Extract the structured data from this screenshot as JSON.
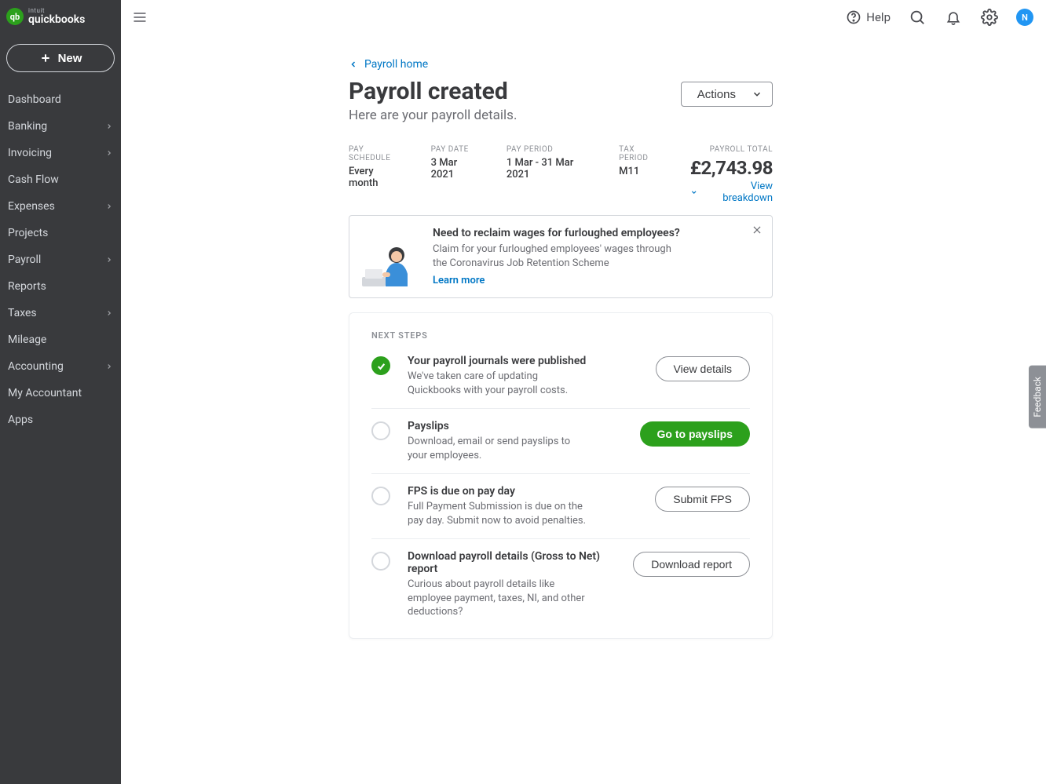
{
  "brand": {
    "intuit": "intuit",
    "name": "quickbooks",
    "mark": "qb"
  },
  "new_button": "New",
  "sidebar_items": [
    {
      "label": "Dashboard",
      "hasSub": false
    },
    {
      "label": "Banking",
      "hasSub": true
    },
    {
      "label": "Invoicing",
      "hasSub": true
    },
    {
      "label": "Cash Flow",
      "hasSub": false
    },
    {
      "label": "Expenses",
      "hasSub": true
    },
    {
      "label": "Projects",
      "hasSub": false
    },
    {
      "label": "Payroll",
      "hasSub": true
    },
    {
      "label": "Reports",
      "hasSub": false
    },
    {
      "label": "Taxes",
      "hasSub": true
    },
    {
      "label": "Mileage",
      "hasSub": false
    },
    {
      "label": "Accounting",
      "hasSub": true
    },
    {
      "label": "My Accountant",
      "hasSub": false
    },
    {
      "label": "Apps",
      "hasSub": false
    }
  ],
  "topbar": {
    "help_label": "Help",
    "avatar_initial": "N"
  },
  "breadcrumb": {
    "back_label": "Payroll home"
  },
  "page": {
    "title": "Payroll created",
    "subtitle": "Here are your payroll details.",
    "actions_label": "Actions"
  },
  "meta": {
    "pay_schedule_label": "PAY SCHEDULE",
    "pay_schedule_value": "Every month",
    "pay_date_label": "PAY DATE",
    "pay_date_value": "3 Mar 2021",
    "pay_period_label": "PAY PERIOD",
    "pay_period_value": "1 Mar - 31 Mar 2021",
    "tax_period_label": "TAX PERIOD",
    "tax_period_value": "M11",
    "payroll_total_label": "PAYROLL TOTAL",
    "payroll_total_value": "£2,743.98",
    "view_breakdown_label": "View breakdown"
  },
  "alert": {
    "title": "Need to reclaim wages for furloughed employees?",
    "desc": "Claim for your furloughed employees' wages through the Coronavirus Job Retention Scheme",
    "link": "Learn more"
  },
  "next_steps_heading": "NEXT STEPS",
  "steps": [
    {
      "done": true,
      "title": "Your payroll journals were published",
      "desc": "We've taken care of updating Quickbooks with your payroll costs.",
      "action": "View details",
      "primary": false
    },
    {
      "done": false,
      "title": "Payslips",
      "desc": "Download, email or send payslips to your employees.",
      "action": "Go to payslips",
      "primary": true
    },
    {
      "done": false,
      "title": "FPS is due on pay day",
      "desc": "Full Payment Submission is due on the pay day. Submit now to avoid penalties.",
      "action": "Submit FPS",
      "primary": false
    },
    {
      "done": false,
      "title": "Download payroll details (Gross to Net) report",
      "desc": "Curious about payroll details like employee payment, taxes, NI, and other deductions?",
      "action": "Download report",
      "primary": false
    }
  ],
  "feedback_label": "Feedback"
}
